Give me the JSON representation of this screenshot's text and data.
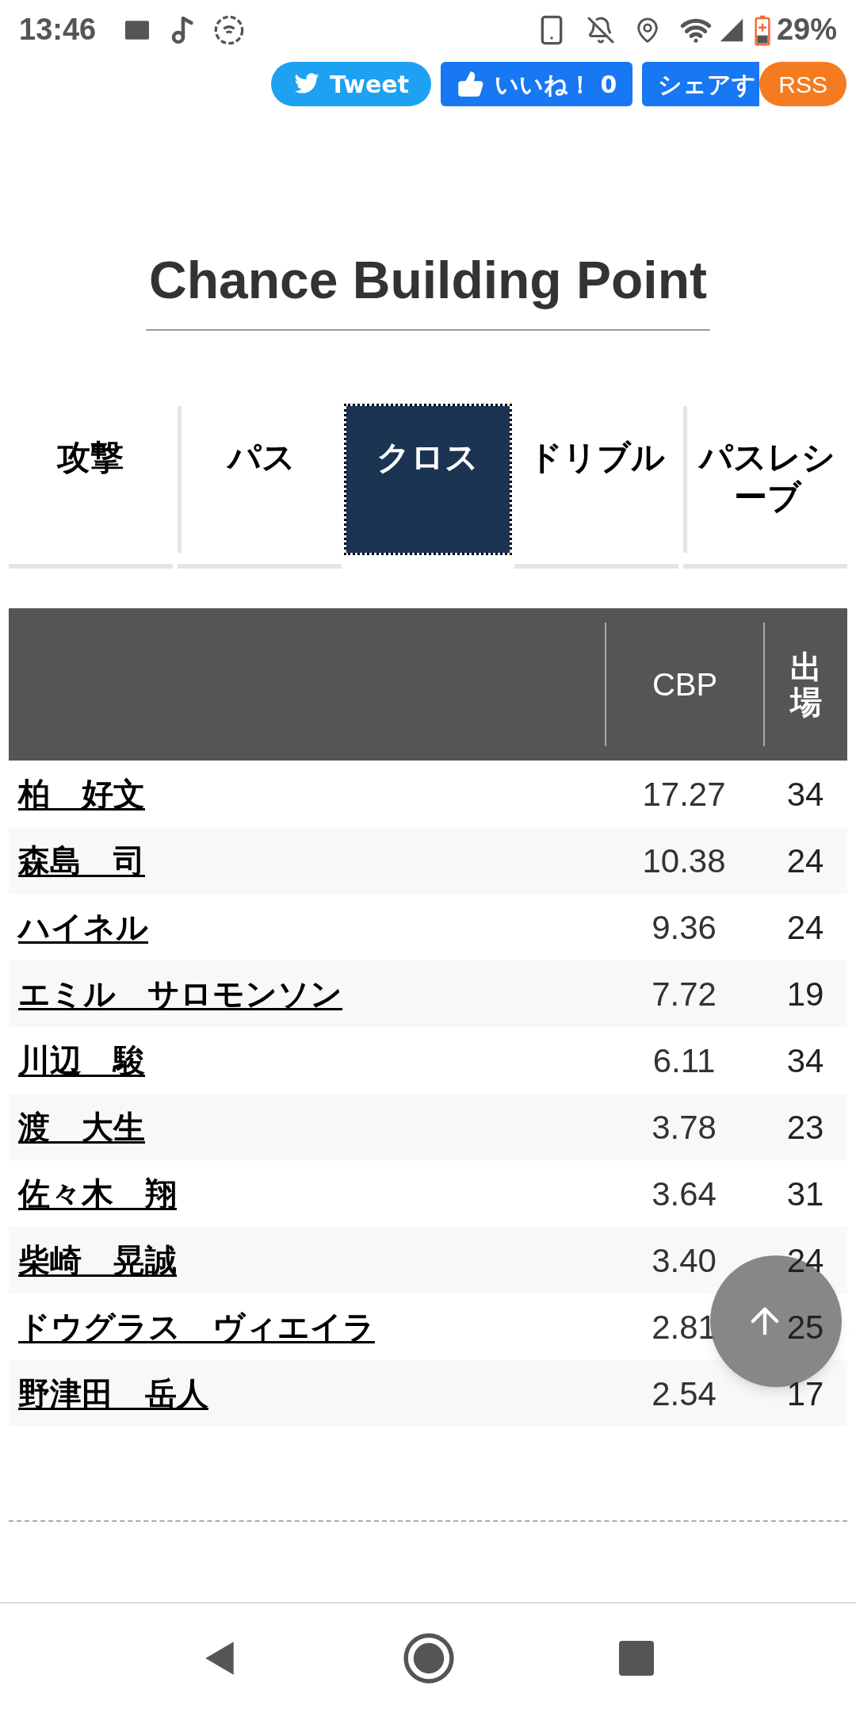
{
  "status_bar": {
    "time": "13:46",
    "battery": "29%"
  },
  "share_buttons": [
    {
      "kind": "tweet",
      "label": "Tweet"
    },
    {
      "kind": "like",
      "label": "いいね！ 0"
    },
    {
      "kind": "share",
      "label": "シェアす"
    },
    {
      "kind": "rss",
      "label": "RSS"
    }
  ],
  "title": "Chance Building Point",
  "tabs": [
    {
      "label": "攻撃",
      "selected": false
    },
    {
      "label": "パス",
      "selected": false
    },
    {
      "label": "クロス",
      "selected": true
    },
    {
      "label": "ドリブル",
      "selected": false
    },
    {
      "label": "パスレシーブ",
      "selected": false
    }
  ],
  "table": {
    "columns": [
      "CBP",
      "出場"
    ],
    "rows": [
      {
        "name": "柏　好文",
        "cbp": "17.27",
        "apps": "34"
      },
      {
        "name": "森島　司",
        "cbp": "10.38",
        "apps": "24"
      },
      {
        "name": "ハイネル",
        "cbp": "9.36",
        "apps": "24"
      },
      {
        "name": "エミル　サロモンソン",
        "cbp": "7.72",
        "apps": "19"
      },
      {
        "name": "川辺　駿",
        "cbp": "6.11",
        "apps": "34"
      },
      {
        "name": "渡　大生",
        "cbp": "3.78",
        "apps": "23"
      },
      {
        "name": "佐々木　翔",
        "cbp": "3.64",
        "apps": "31"
      },
      {
        "name": "柴崎　晃誠",
        "cbp": "3.40",
        "apps": "24"
      },
      {
        "name": "ドウグラス　ヴィエイラ",
        "cbp": "2.81",
        "apps": "25"
      },
      {
        "name": "野津田　岳人",
        "cbp": "2.54",
        "apps": "17"
      }
    ]
  }
}
